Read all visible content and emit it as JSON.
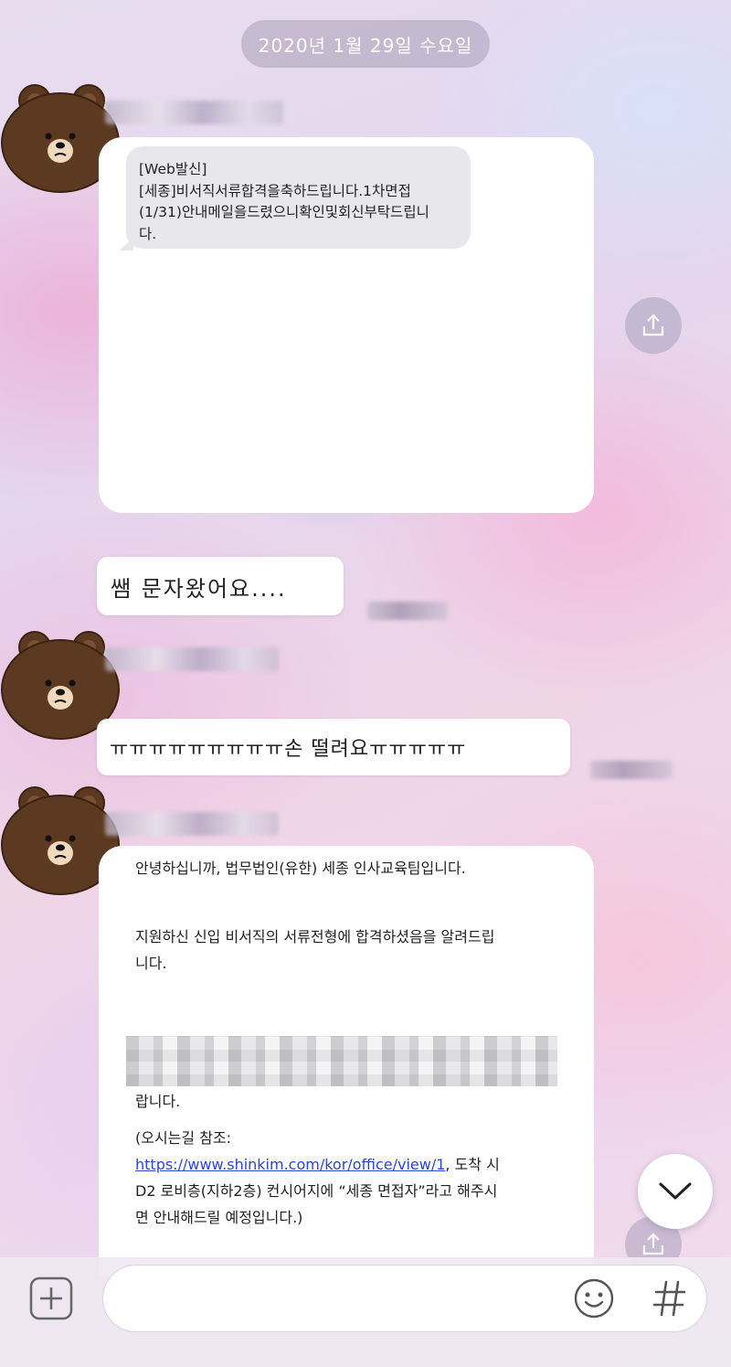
{
  "chat": {
    "date_divider": "2020년 1월 29일 수요일"
  },
  "messages": [
    {
      "sms_card": {
        "lines": [
          "[Web발신]",
          "[세종]비서직서류합격을축하드립니다.1차면접",
          "(1/31)안내메일을드렸으니확인및회신부탁드립니",
          "다."
        ]
      }
    },
    {
      "text": "쌤 문자왔어요...."
    },
    {
      "text": "ㅠㅠㅠㅠㅠㅠㅠㅠㅠ손 떨려요ㅠㅠㅠㅠㅠ"
    },
    {
      "email_card": {
        "greeting": "안녕하십니까, 법무법인(유한) 세종 인사교육팀입니다.",
        "pass_line1": "지원하신 신입 비서직의 서류전형에 합격하셨음을 알려드립",
        "pass_line2": "니다.",
        "trailing": "랍니다.",
        "directions_label": "(오시는길 참조:",
        "link": "https://www.shinkim.com/kor/office/view/1",
        "after_link": ", 도착 시",
        "line2": "D2 로비층(지하2층) 컨시어지에 “세종 면접자”라고 해주시",
        "line3": "면 안내해드릴 예정입니다.)"
      }
    }
  ],
  "icons": {
    "avatar": "brown-bear-avatar-icon",
    "share": "share-icon",
    "scroll_down": "chevron-down-icon",
    "add": "plus-square-icon",
    "emoji": "emoji-icon",
    "hashtag": "hashtag-icon"
  },
  "colors": {
    "bear_brown": "#5c3a21",
    "link_blue": "#2a46d6"
  }
}
